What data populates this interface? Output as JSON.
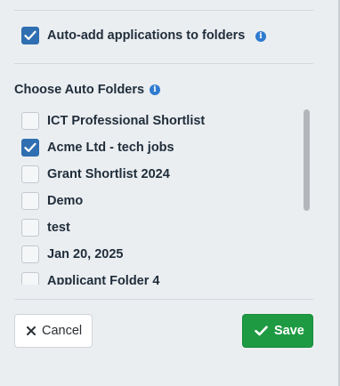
{
  "auto_add": {
    "label": "Auto-add applications to folders",
    "checked": true,
    "info_icon": "info-circle-icon"
  },
  "auto_folders": {
    "heading": "Choose Auto Folders",
    "info_icon": "info-circle-icon",
    "items": [
      {
        "label": "ICT Professional Shortlist",
        "checked": false
      },
      {
        "label": "Acme Ltd - tech jobs",
        "checked": true
      },
      {
        "label": "Grant Shortlist 2024",
        "checked": false
      },
      {
        "label": "Demo",
        "checked": false
      },
      {
        "label": "test",
        "checked": false
      },
      {
        "label": "Jan 20, 2025",
        "checked": false
      },
      {
        "label": "Applicant Folder 4",
        "checked": false
      }
    ]
  },
  "footer": {
    "cancel_label": "Cancel",
    "cancel_icon": "close-icon",
    "save_label": "Save",
    "save_icon": "check-icon"
  },
  "colors": {
    "accent": "#2f6fb1",
    "info": "#2f7bd0",
    "save": "#1e9a43",
    "background": "#ebeef1"
  }
}
